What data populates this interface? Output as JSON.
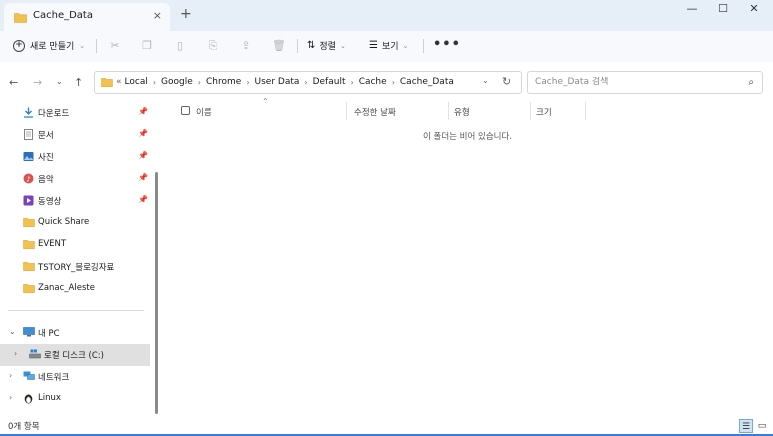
{
  "window": {
    "tab_title": "Cache_Data",
    "tab_close": "×",
    "new_tab": "+",
    "minimize": "—",
    "maximize": "☐",
    "close": "✕"
  },
  "toolbar": {
    "new_label": "새로 만들기",
    "sort_label": "정렬",
    "view_label": "보기",
    "more_label": "•••"
  },
  "address": {
    "overflow": "«",
    "crumbs": [
      "Local",
      "Google",
      "Chrome",
      "User Data",
      "Default",
      "Cache",
      "Cache_Data"
    ],
    "search_placeholder": "Cache_Data 검색"
  },
  "sidebar": {
    "quick_access": [
      {
        "label": "다운로드",
        "icon": "download-icon",
        "pinned": true
      },
      {
        "label": "문서",
        "icon": "document-icon",
        "pinned": true
      },
      {
        "label": "사진",
        "icon": "pictures-icon",
        "pinned": true
      },
      {
        "label": "음악",
        "icon": "music-icon",
        "pinned": true
      },
      {
        "label": "동영상",
        "icon": "video-icon",
        "pinned": true
      },
      {
        "label": "Quick Share",
        "icon": "folder-icon",
        "pinned": false
      },
      {
        "label": "EVENT",
        "icon": "folder-icon",
        "pinned": false
      },
      {
        "label": "TSTORY_블로깅자료",
        "icon": "folder-icon",
        "pinned": false
      },
      {
        "label": "Zanac_Aleste",
        "icon": "folder-icon",
        "pinned": false
      }
    ],
    "this_pc": "내 PC",
    "local_disk": "로컬 디스크 (C:)",
    "network": "네트워크",
    "linux": "Linux"
  },
  "content": {
    "columns": [
      "이름",
      "수정한 날짜",
      "유형",
      "크기"
    ],
    "empty_message": "이 폴더는 비어 있습니다."
  },
  "status": {
    "item_count": "0개 항목"
  },
  "colors": {
    "titlebar": "#e6eef7",
    "folder": "#f2c14e",
    "accent": "#3a7bd5"
  }
}
